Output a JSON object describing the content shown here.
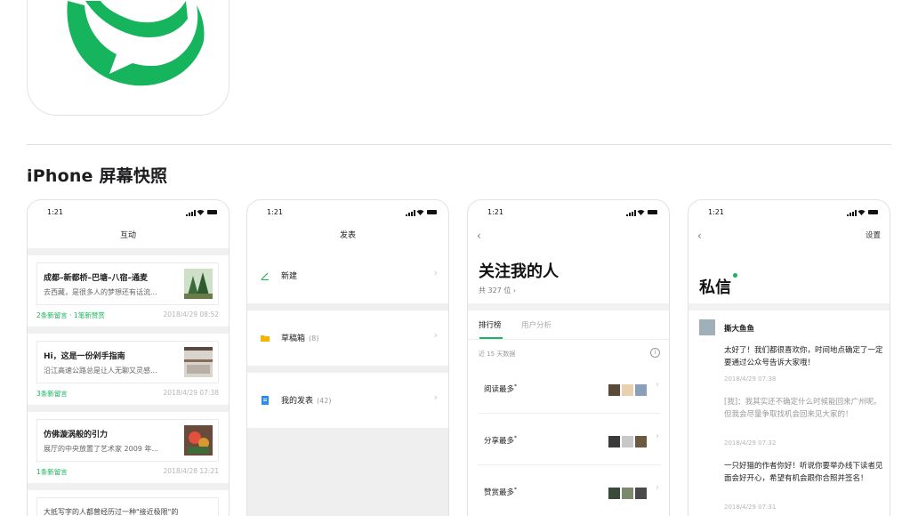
{
  "section_title": "iPhone 屏幕快照",
  "colors": {
    "brand_green": "#16b45c",
    "divider": "#dedede"
  },
  "status_time": "1:21",
  "screens": {
    "interact": {
      "nav_title": "互动",
      "messages": [
        {
          "title": "成都–新都桥–巴塘–八宿–通麦",
          "snippet": "去西藏，是很多人的梦想还有话流...",
          "stats": "2条新留言 · 1笔新赞赏",
          "date": "2018/4/29 08:52"
        },
        {
          "title": "Hi，这是一份剁手指南",
          "snippet": "沿江高速公路总是让人无聊又灵感...",
          "stats": "3条新留言",
          "date": "2018/4/29 07:38"
        },
        {
          "title": "仿佛漩涡般的引力",
          "snippet": "展厅的中央放置了艺术家 2009 年...",
          "stats": "1条新留言",
          "date": "2018/4/28 12:21"
        },
        {
          "title": "大抵写字的人都曾经历过一种\"接近极限\"的",
          "snippet": "",
          "stats": "",
          "date": ""
        }
      ]
    },
    "publish": {
      "nav_title": "发表",
      "items": [
        {
          "label": "新建",
          "count": ""
        },
        {
          "label": "草稿箱",
          "count": "(8)"
        },
        {
          "label": "我的发表",
          "count": "(42)"
        }
      ]
    },
    "followers": {
      "title": "关注我的人",
      "count_text": "共 327 位",
      "tabs": [
        "排行榜",
        "用户分析"
      ],
      "range": "近 15 天数据",
      "rows": [
        {
          "label": "阅读最多"
        },
        {
          "label": "分享最多"
        },
        {
          "label": "赞赏最多"
        }
      ]
    },
    "messages": {
      "nav_right": "设置",
      "title": "私信",
      "sender": "撕大鱼鱼",
      "thread": [
        {
          "text": "太好了！我们都很喜欢你，时间地点确定了一定要通过公众号告诉大家哦！",
          "date": "2018/4/29 07:38",
          "reply": false
        },
        {
          "text": "[我]：我其实还不确定什么时候能回来广州呢。但我会尽量争取找机会回来见大家的！",
          "date": "2018/4/29 07:32",
          "reply": true
        },
        {
          "text": "一只好猫的作者你好！听说你要举办线下读者见面会好开心，希望有机会跟你合照并签名！",
          "date": "2018/4/29 07:31",
          "reply": false
        }
      ]
    }
  }
}
